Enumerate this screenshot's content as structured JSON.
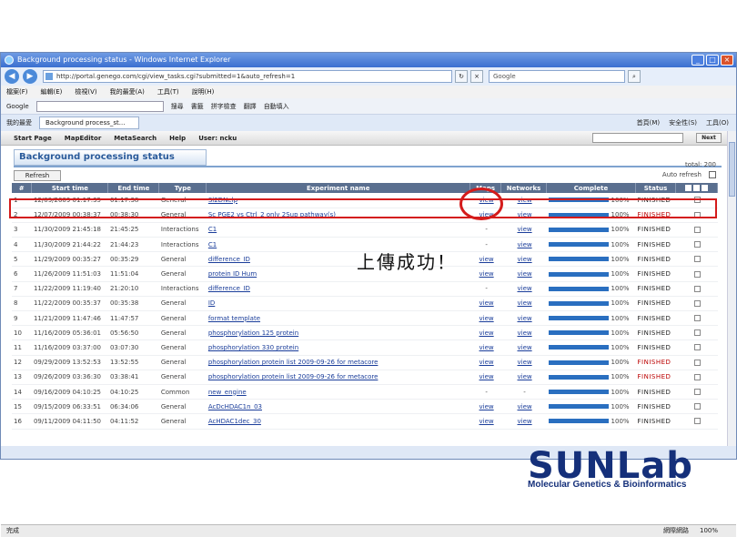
{
  "window": {
    "title": "Background processing status - Windows Internet Explorer",
    "address": "http://portal.genego.com/cgi/view_tasks.cgi?submitted=1&auto_refresh=1",
    "search_engine": "Google"
  },
  "menu": [
    "檔案(F)",
    "編輯(E)",
    "檢視(V)",
    "我的最愛(A)",
    "工具(T)",
    "說明(H)"
  ],
  "google_bar": {
    "label": "Google",
    "items": [
      "搜尋",
      "書籤",
      "拼字檢查",
      "翻譯",
      "自動填入"
    ]
  },
  "tabs": {
    "favorites": "我的最愛",
    "current": "Background process_st...",
    "right": [
      "首頁(M)",
      "安全性(S)",
      "工具(O)"
    ]
  },
  "app_nav": {
    "items": [
      "Start Page",
      "MapEditor",
      "MetaSearch",
      "Help",
      "User: ncku"
    ],
    "next_label": "Next"
  },
  "panel": {
    "title": "Background processing status",
    "total_label": "total: 200",
    "refresh_label": "Refresh",
    "auto_refresh_label": "Auto refresh"
  },
  "table": {
    "columns": [
      "#",
      "Start time",
      "End time",
      "Type",
      "Experiment name",
      "Maps",
      "Networks",
      "Complete",
      "Status"
    ],
    "rows": [
      {
        "n": "1",
        "start": "12/09/2009 01:17:35",
        "end": "01:17:38",
        "type": "General",
        "name": "Sl2DNelp",
        "maps": "view",
        "networks": "view",
        "complete": "100%",
        "status": "FINISHED"
      },
      {
        "n": "2",
        "start": "12/07/2009 00:38:37",
        "end": "00:38:30",
        "type": "General",
        "name": "Sc PGE2 vs Ctrl_2 only 2Sup pathway(s)",
        "maps": "view",
        "networks": "view",
        "complete": "100%",
        "status": "FINISHED"
      },
      {
        "n": "3",
        "start": "11/30/2009 21:45:18",
        "end": "21:45:25",
        "type": "Interactions",
        "name": "C1",
        "maps": "-",
        "networks": "view",
        "complete": "100%",
        "status": "FINISHED"
      },
      {
        "n": "4",
        "start": "11/30/2009 21:44:22",
        "end": "21:44:23",
        "type": "Interactions",
        "name": "C1",
        "maps": "-",
        "networks": "view",
        "complete": "100%",
        "status": "FINISHED"
      },
      {
        "n": "5",
        "start": "11/29/2009 00:35:27",
        "end": "00:35:29",
        "type": "General",
        "name": "difference_ID",
        "maps": "view",
        "networks": "view",
        "complete": "100%",
        "status": "FINISHED"
      },
      {
        "n": "6",
        "start": "11/26/2009 11:51:03",
        "end": "11:51:04",
        "type": "General",
        "name": "protein ID Hum",
        "maps": "view",
        "networks": "view",
        "complete": "100%",
        "status": "FINISHED"
      },
      {
        "n": "7",
        "start": "11/22/2009 11:19:40",
        "end": "21:20:10",
        "type": "Interactions",
        "name": "difference_ID",
        "maps": "-",
        "networks": "view",
        "complete": "100%",
        "status": "FINISHED"
      },
      {
        "n": "8",
        "start": "11/22/2009 00:35:37",
        "end": "00:35:38",
        "type": "General",
        "name": "ID",
        "maps": "view",
        "networks": "view",
        "complete": "100%",
        "status": "FINISHED"
      },
      {
        "n": "9",
        "start": "11/21/2009 11:47:46",
        "end": "11:47:57",
        "type": "General",
        "name": "format template",
        "maps": "view",
        "networks": "view",
        "complete": "100%",
        "status": "FINISHED"
      },
      {
        "n": "10",
        "start": "11/16/2009 05:36:01",
        "end": "05:56:50",
        "type": "General",
        "name": "phosphorylation 125 protein",
        "maps": "view",
        "networks": "view",
        "complete": "100%",
        "status": "FINISHED"
      },
      {
        "n": "11",
        "start": "11/16/2009 03:37:00",
        "end": "03:07:30",
        "type": "General",
        "name": "phosphorylation 330 protein",
        "maps": "view",
        "networks": "view",
        "complete": "100%",
        "status": "FINISHED"
      },
      {
        "n": "12",
        "start": "09/29/2009 13:52:53",
        "end": "13:52:55",
        "type": "General",
        "name": "phosphorylation protein list 2009-09-26 for metacore",
        "maps": "view",
        "networks": "view",
        "complete": "100%",
        "status": "FINISHED"
      },
      {
        "n": "13",
        "start": "09/26/2009 03:36:30",
        "end": "03:38:41",
        "type": "General",
        "name": "phosphorylation protein list 2009-09-26 for metacore",
        "maps": "view",
        "networks": "view",
        "complete": "100%",
        "status": "FINISHED"
      },
      {
        "n": "14",
        "start": "09/16/2009 04:10:25",
        "end": "04:10:25",
        "type": "Common",
        "name": "new_engine",
        "maps": "-",
        "networks": "-",
        "complete": "100%",
        "status": "FINISHED"
      },
      {
        "n": "15",
        "start": "09/15/2009 06:33:51",
        "end": "06:34:06",
        "type": "General",
        "name": "AcDcHDAC1n_03",
        "maps": "view",
        "networks": "view",
        "complete": "100%",
        "status": "FINISHED"
      },
      {
        "n": "16",
        "start": "09/11/2009 04:11:50",
        "end": "04:11:52",
        "type": "General",
        "name": "AcHDAC1dec_30",
        "maps": "view",
        "networks": "view",
        "complete": "100%",
        "status": "FINISHED"
      }
    ]
  },
  "statusbar": {
    "left": "完成",
    "zone": "網際網路",
    "zoom": "100%"
  },
  "annotation": "上傳成功！",
  "logo": {
    "word": "SUNLab",
    "subtitle": "Molecular Genetics & Bioinformatics"
  },
  "colors": {
    "highlight": "#d41b1b",
    "header_bg": "#5a6f8f",
    "link": "#1a3d9a",
    "progress": "#2a6fc0",
    "logo": "#15307a"
  }
}
